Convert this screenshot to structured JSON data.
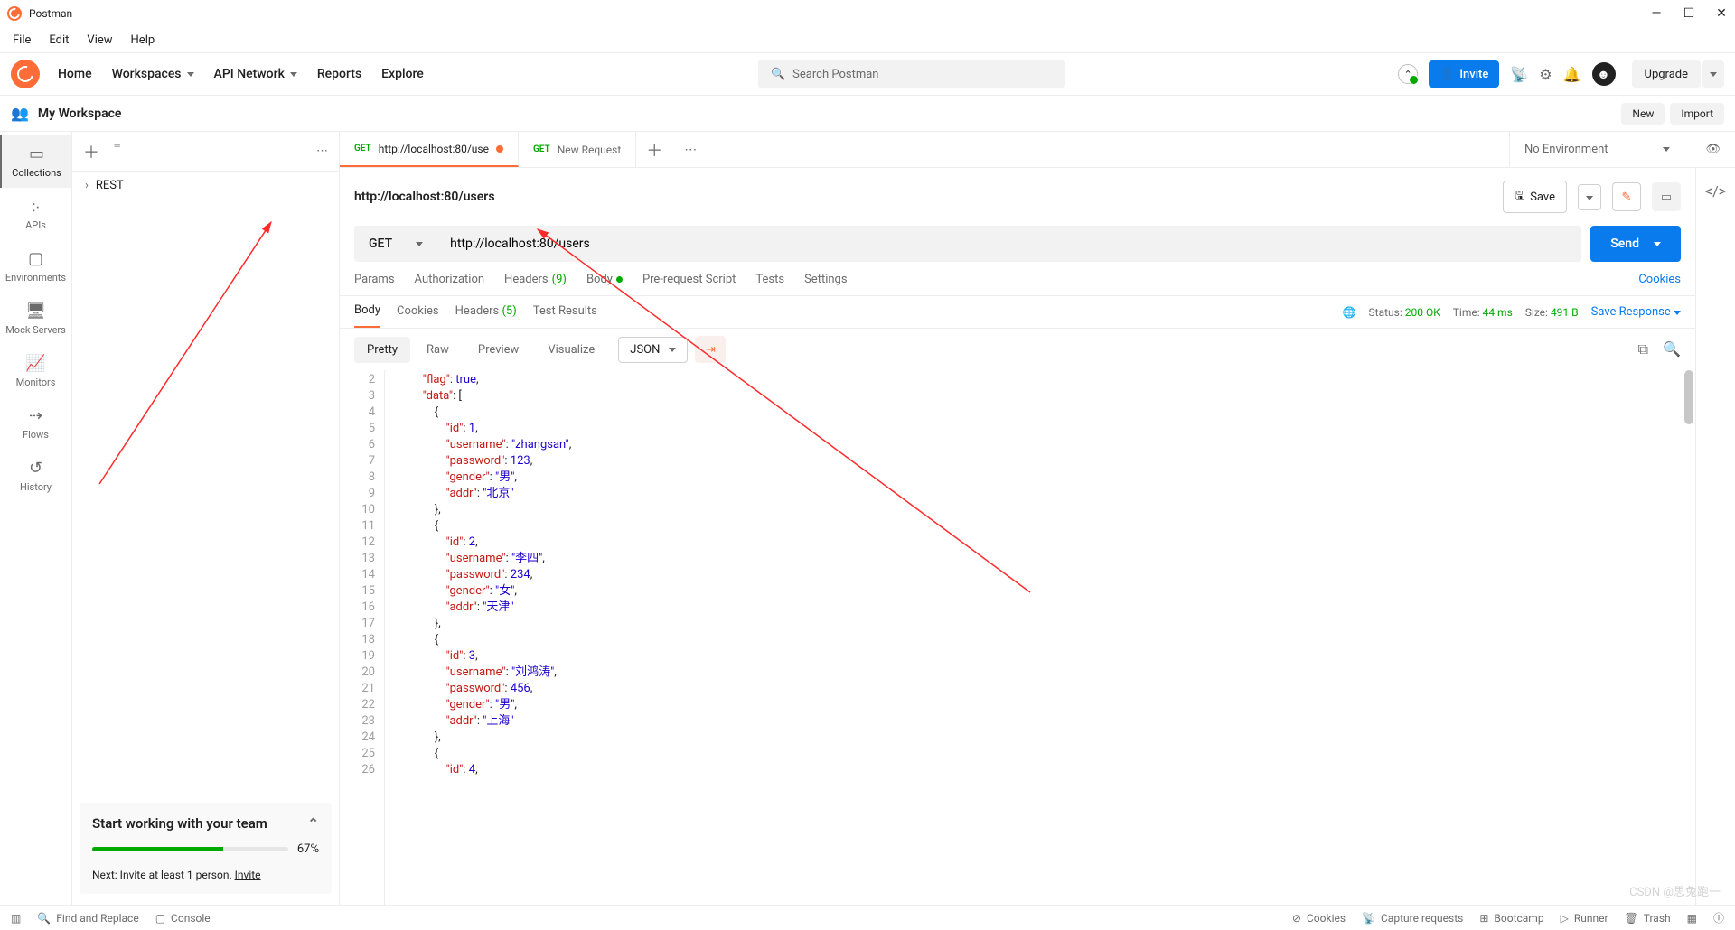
{
  "titlebar": {
    "app_name": "Postman"
  },
  "menubar": {
    "items": [
      "File",
      "Edit",
      "View",
      "Help"
    ]
  },
  "topnav": {
    "home": "Home",
    "workspaces": "Workspaces",
    "api_network": "API Network",
    "reports": "Reports",
    "explore": "Explore",
    "search_placeholder": "Search Postman",
    "invite": "Invite",
    "upgrade": "Upgrade"
  },
  "workspace": {
    "name": "My Workspace",
    "new_btn": "New",
    "import_btn": "Import"
  },
  "rail": {
    "collections": "Collections",
    "apis": "APIs",
    "envs": "Environments",
    "mock": "Mock Servers",
    "monitors": "Monitors",
    "flows": "Flows",
    "history": "History"
  },
  "tree": {
    "item1": "REST"
  },
  "team_card": {
    "title": "Start working with your team",
    "percent": "67%",
    "next": "Next: Invite at least 1 person. ",
    "invite_link": "Invite"
  },
  "tabs": {
    "t1_label": "http://localhost:80/use",
    "t2_label": "New Request",
    "env_label": "No Environment"
  },
  "request": {
    "title": "http://localhost:80/users",
    "save": "Save",
    "method": "GET",
    "url": "http://localhost:80/users",
    "send": "Send"
  },
  "req_tabs": {
    "params": "Params",
    "auth": "Authorization",
    "headers": "Headers",
    "headers_badge": "(9)",
    "body": "Body",
    "prereq": "Pre-request Script",
    "tests": "Tests",
    "settings": "Settings",
    "cookies": "Cookies"
  },
  "resp_tabs": {
    "body": "Body",
    "cookies": "Cookies",
    "headers": "Headers",
    "headers_badge": "(5)",
    "tests": "Test Results",
    "status_label": "Status:",
    "status_val": "200 OK",
    "time_label": "Time:",
    "time_val": "44 ms",
    "size_label": "Size:",
    "size_val": "491 B",
    "save": "Save Response"
  },
  "view": {
    "pretty": "Pretty",
    "raw": "Raw",
    "preview": "Preview",
    "vis": "Visualize",
    "fmt": "JSON"
  },
  "code": {
    "first_line_no": 2,
    "lines": [
      {
        "indent": 2,
        "tokens": [
          {
            "t": "k",
            "v": "\"flag\""
          },
          {
            "t": "p",
            "v": ": "
          },
          {
            "t": "b",
            "v": "true"
          },
          {
            "t": "p",
            "v": ","
          }
        ]
      },
      {
        "indent": 2,
        "tokens": [
          {
            "t": "k",
            "v": "\"data\""
          },
          {
            "t": "p",
            "v": ": ["
          }
        ]
      },
      {
        "indent": 3,
        "tokens": [
          {
            "t": "p",
            "v": "{"
          }
        ]
      },
      {
        "indent": 4,
        "tokens": [
          {
            "t": "k",
            "v": "\"id\""
          },
          {
            "t": "p",
            "v": ": "
          },
          {
            "t": "n",
            "v": "1"
          },
          {
            "t": "p",
            "v": ","
          }
        ]
      },
      {
        "indent": 4,
        "tokens": [
          {
            "t": "k",
            "v": "\"username\""
          },
          {
            "t": "p",
            "v": ": "
          },
          {
            "t": "v",
            "v": "\"zhangsan\""
          },
          {
            "t": "p",
            "v": ","
          }
        ]
      },
      {
        "indent": 4,
        "tokens": [
          {
            "t": "k",
            "v": "\"password\""
          },
          {
            "t": "p",
            "v": ": "
          },
          {
            "t": "n",
            "v": "123"
          },
          {
            "t": "p",
            "v": ","
          }
        ]
      },
      {
        "indent": 4,
        "tokens": [
          {
            "t": "k",
            "v": "\"gender\""
          },
          {
            "t": "p",
            "v": ": "
          },
          {
            "t": "v",
            "v": "\"男\""
          },
          {
            "t": "p",
            "v": ","
          }
        ]
      },
      {
        "indent": 4,
        "tokens": [
          {
            "t": "k",
            "v": "\"addr\""
          },
          {
            "t": "p",
            "v": ": "
          },
          {
            "t": "v",
            "v": "\"北京\""
          }
        ]
      },
      {
        "indent": 3,
        "tokens": [
          {
            "t": "p",
            "v": "},"
          }
        ]
      },
      {
        "indent": 3,
        "tokens": [
          {
            "t": "p",
            "v": "{"
          }
        ]
      },
      {
        "indent": 4,
        "tokens": [
          {
            "t": "k",
            "v": "\"id\""
          },
          {
            "t": "p",
            "v": ": "
          },
          {
            "t": "n",
            "v": "2"
          },
          {
            "t": "p",
            "v": ","
          }
        ]
      },
      {
        "indent": 4,
        "tokens": [
          {
            "t": "k",
            "v": "\"username\""
          },
          {
            "t": "p",
            "v": ": "
          },
          {
            "t": "v",
            "v": "\"李四\""
          },
          {
            "t": "p",
            "v": ","
          }
        ]
      },
      {
        "indent": 4,
        "tokens": [
          {
            "t": "k",
            "v": "\"password\""
          },
          {
            "t": "p",
            "v": ": "
          },
          {
            "t": "n",
            "v": "234"
          },
          {
            "t": "p",
            "v": ","
          }
        ]
      },
      {
        "indent": 4,
        "tokens": [
          {
            "t": "k",
            "v": "\"gender\""
          },
          {
            "t": "p",
            "v": ": "
          },
          {
            "t": "v",
            "v": "\"女\""
          },
          {
            "t": "p",
            "v": ","
          }
        ]
      },
      {
        "indent": 4,
        "tokens": [
          {
            "t": "k",
            "v": "\"addr\""
          },
          {
            "t": "p",
            "v": ": "
          },
          {
            "t": "v",
            "v": "\"天津\""
          }
        ]
      },
      {
        "indent": 3,
        "tokens": [
          {
            "t": "p",
            "v": "},"
          }
        ]
      },
      {
        "indent": 3,
        "tokens": [
          {
            "t": "p",
            "v": "{"
          }
        ]
      },
      {
        "indent": 4,
        "tokens": [
          {
            "t": "k",
            "v": "\"id\""
          },
          {
            "t": "p",
            "v": ": "
          },
          {
            "t": "n",
            "v": "3"
          },
          {
            "t": "p",
            "v": ","
          }
        ]
      },
      {
        "indent": 4,
        "tokens": [
          {
            "t": "k",
            "v": "\"username\""
          },
          {
            "t": "p",
            "v": ": "
          },
          {
            "t": "v",
            "v": "\"刘鸿涛\""
          },
          {
            "t": "p",
            "v": ","
          }
        ]
      },
      {
        "indent": 4,
        "tokens": [
          {
            "t": "k",
            "v": "\"password\""
          },
          {
            "t": "p",
            "v": ": "
          },
          {
            "t": "n",
            "v": "456"
          },
          {
            "t": "p",
            "v": ","
          }
        ]
      },
      {
        "indent": 4,
        "tokens": [
          {
            "t": "k",
            "v": "\"gender\""
          },
          {
            "t": "p",
            "v": ": "
          },
          {
            "t": "v",
            "v": "\"男\""
          },
          {
            "t": "p",
            "v": ","
          }
        ]
      },
      {
        "indent": 4,
        "tokens": [
          {
            "t": "k",
            "v": "\"addr\""
          },
          {
            "t": "p",
            "v": ": "
          },
          {
            "t": "v",
            "v": "\"上海\""
          }
        ]
      },
      {
        "indent": 3,
        "tokens": [
          {
            "t": "p",
            "v": "},"
          }
        ]
      },
      {
        "indent": 3,
        "tokens": [
          {
            "t": "p",
            "v": "{"
          }
        ]
      },
      {
        "indent": 4,
        "tokens": [
          {
            "t": "k",
            "v": "\"id\""
          },
          {
            "t": "p",
            "v": ": "
          },
          {
            "t": "n",
            "v": "4"
          },
          {
            "t": "p",
            "v": ","
          }
        ]
      }
    ]
  },
  "footer": {
    "find": "Find and Replace",
    "console": "Console",
    "cookies": "Cookies",
    "capture": "Capture requests",
    "bootcamp": "Bootcamp",
    "runner": "Runner",
    "trash": "Trash"
  },
  "watermark": "CSDN @思兔跑一"
}
